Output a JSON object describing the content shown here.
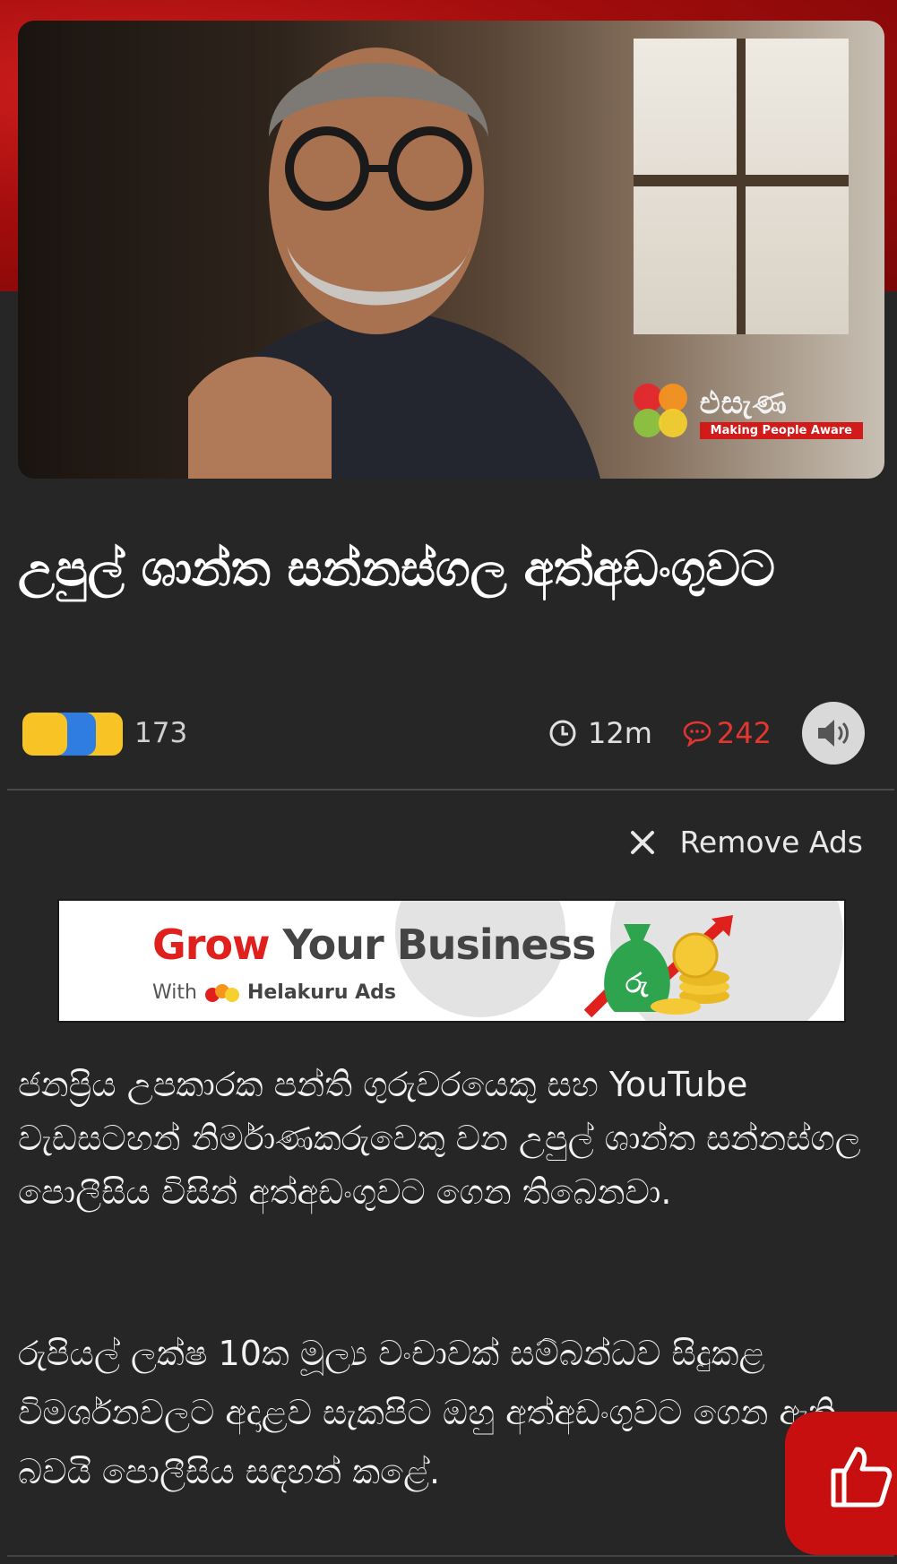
{
  "hero": {
    "image_alt": "man with grey beard and round glasses",
    "logo_name": "එසැණ",
    "logo_tagline": "Making People Aware"
  },
  "article": {
    "title": "උපුල් ශාන්ත සන්නස්ගල අත්අඩංගුවට",
    "reaction_count": "173",
    "read_time": "12m",
    "comment_count": "242"
  },
  "ads": {
    "remove_label": "Remove Ads",
    "banner_headline_1": "Grow",
    "banner_headline_2": " Your Business",
    "banner_sub_prefix": "With",
    "banner_sub_brand": "Helakuru Ads",
    "banner_coin_label": "රු"
  },
  "body": {
    "p1": "ජනප්‍රිය උපකාරක පන්ති ගුරුවරයෙකු සහ YouTube වැඩසටහන් නිර්මාණකරුවෙකු වන උපුල් ශාන්ත සන්නස්ගල පොලීසිය විසින් අත්අඩංගුවට ගෙන තිබෙනවා.",
    "p2": "රුපියල් ලක්ෂ 10ක මූල්‍ය වංචාවක් සම්බන්ධව සිදුකළ විමර්ශනවලට අදාළව සැකපිට ඔහු අත්අඩංගුවට ගෙන ඇති බවයි පොලීසිය සඳහන් කළේ."
  },
  "colors": {
    "accent_red": "#d11a1a",
    "background": "#262626",
    "comment_red": "#e2362e"
  }
}
